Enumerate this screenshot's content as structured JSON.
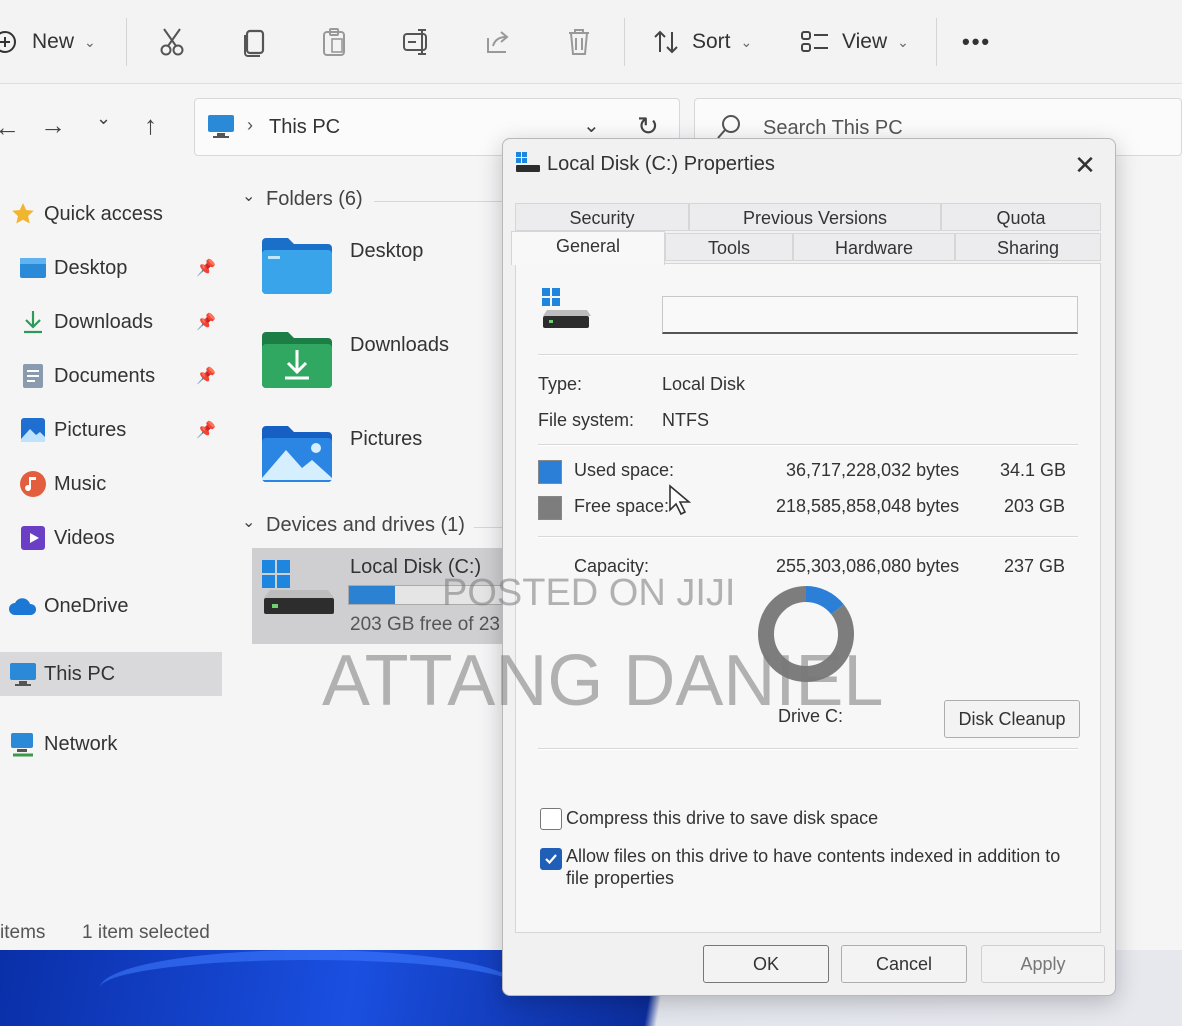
{
  "toolbar": {
    "new_label": "New",
    "sort_label": "Sort",
    "view_label": "View",
    "more_label": "•••"
  },
  "address": {
    "location": "This PC",
    "search_placeholder": "Search This PC"
  },
  "sidebar": {
    "items": [
      {
        "label": "Quick access",
        "icon": "star-icon"
      },
      {
        "label": "Desktop",
        "icon": "desktop-icon",
        "pinned": true
      },
      {
        "label": "Downloads",
        "icon": "download-icon",
        "pinned": true
      },
      {
        "label": "Documents",
        "icon": "document-icon",
        "pinned": true
      },
      {
        "label": "Pictures",
        "icon": "pictures-icon",
        "pinned": true
      },
      {
        "label": "Music",
        "icon": "music-icon"
      },
      {
        "label": "Videos",
        "icon": "videos-icon"
      },
      {
        "label": "OneDrive",
        "icon": "cloud-icon"
      },
      {
        "label": "This PC",
        "icon": "computer-icon",
        "selected": true
      },
      {
        "label": "Network",
        "icon": "network-icon"
      }
    ]
  },
  "content": {
    "folders_header": "Folders (6)",
    "folders": [
      "Desktop",
      "Downloads",
      "Pictures"
    ],
    "devices_header": "Devices and drives (1)",
    "drive": {
      "name": "Local Disk (C:)",
      "free_text": "203 GB free of 23",
      "used_fraction": 0.3
    }
  },
  "status": {
    "items": "items",
    "selected": "1 item selected"
  },
  "dialog": {
    "title": "Local Disk (C:) Properties",
    "close": "✕",
    "tabs_row1": [
      "Security",
      "Previous Versions",
      "Quota"
    ],
    "tabs_row2": [
      "General",
      "Tools",
      "Hardware",
      "Sharing"
    ],
    "active_tab": "General",
    "name_value": "",
    "type_label": "Type:",
    "type_value": "Local Disk",
    "fs_label": "File system:",
    "fs_value": "NTFS",
    "used_label": "Used space:",
    "used_bytes": "36,717,228,032 bytes",
    "used_gb": "34.1 GB",
    "free_label": "Free space:",
    "free_bytes": "218,585,858,048 bytes",
    "free_gb": "203 GB",
    "capacity_label": "Capacity:",
    "capacity_bytes": "255,303,086,080 bytes",
    "capacity_gb": "237 GB",
    "drive_label": "Drive C:",
    "cleanup_label": "Disk Cleanup",
    "compress_label": "Compress this drive to save disk space",
    "compress_checked": false,
    "index_label": "Allow files on this drive to have contents indexed in addition to",
    "index_label2": "file properties",
    "index_checked": true,
    "ok_label": "OK",
    "cancel_label": "Cancel",
    "apply_label": "Apply"
  },
  "chart_data": {
    "type": "pie",
    "categories": [
      "Used space",
      "Free space"
    ],
    "values": [
      34.1,
      203
    ],
    "colors": [
      "#2b7fd6",
      "#7d7d7d"
    ]
  },
  "colors": {
    "used": "#2b7fd6",
    "free": "#7d7d7d",
    "accent": "#1f5fb8"
  },
  "watermark": {
    "line1": "POSTED ON JIJI",
    "line2": "ATTANG DANIEL"
  }
}
